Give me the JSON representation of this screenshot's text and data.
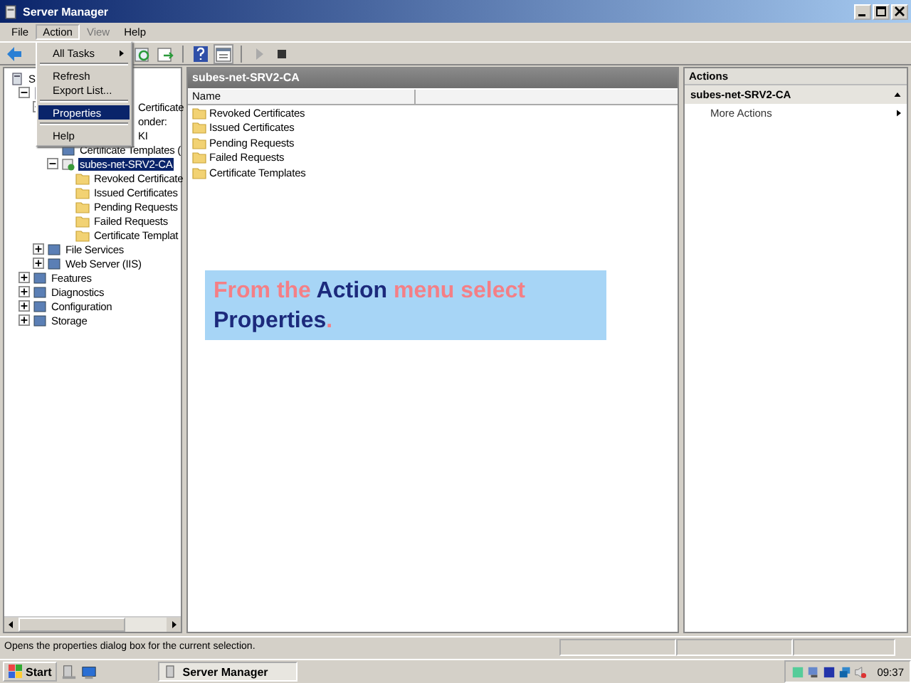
{
  "window": {
    "title": "Server Manager"
  },
  "menu_bar": [
    {
      "label": "File",
      "selected": false
    },
    {
      "label": "Action",
      "selected": true
    },
    {
      "label": "View",
      "selected": false
    },
    {
      "label": "Help",
      "selected": false
    }
  ],
  "action_menu": [
    {
      "kind": "submenu",
      "label": "All Tasks",
      "selected": false
    },
    {
      "kind": "separator"
    },
    {
      "kind": "item",
      "label": "Refresh",
      "selected": false
    },
    {
      "kind": "item",
      "label": "Export List...",
      "selected": false
    },
    {
      "kind": "separator"
    },
    {
      "kind": "item",
      "label": "Properties",
      "selected": true
    },
    {
      "kind": "separator"
    },
    {
      "kind": "item",
      "label": "Help",
      "selected": false
    }
  ],
  "tree": [
    {
      "label": "S",
      "kind": "server",
      "selected": false,
      "children": [
        {
          "kind": "server",
          "expanded": true,
          "selected": false,
          "children": [
            {
              "label": "Certificate",
              "expanded": true,
              "selected": false,
              "covered": true,
              "children": [
                {
                  "label": "onder:",
                  "selected": false,
                  "covered": true
                },
                {
                  "label": "KI",
                  "selected": false,
                  "covered": true
                },
                {
                  "label": "Certificate Templates (",
                  "kind": "node",
                  "selected": false
                },
                {
                  "label": "subes-net-SRV2-CA",
                  "kind": "ca",
                  "expanded": true,
                  "selected": true,
                  "children": [
                    {
                      "label": "Revoked Certificate",
                      "kind": "folder",
                      "selected": false
                    },
                    {
                      "label": "Issued Certificates",
                      "kind": "folder",
                      "selected": false
                    },
                    {
                      "label": "Pending Requests",
                      "kind": "folder",
                      "selected": false
                    },
                    {
                      "label": "Failed Requests",
                      "kind": "folder",
                      "selected": false
                    },
                    {
                      "label": "Certificate Templat",
                      "kind": "folder",
                      "selected": false
                    }
                  ]
                }
              ]
            },
            {
              "label": "File Services",
              "kind": "node",
              "expanded": false,
              "selected": false
            },
            {
              "label": "Web Server (IIS)",
              "kind": "node",
              "expanded": false,
              "selected": false
            }
          ]
        },
        {
          "label": "Features",
          "kind": "node",
          "expanded": false,
          "selected": false
        },
        {
          "label": "Diagnostics",
          "kind": "node",
          "expanded": false,
          "selected": false
        },
        {
          "label": "Configuration",
          "kind": "node",
          "expanded": false,
          "selected": false
        },
        {
          "label": "Storage",
          "kind": "node",
          "expanded": false,
          "selected": false
        }
      ]
    }
  ],
  "center": {
    "title": "subes-net-SRV2-CA",
    "columns": [
      "Name"
    ],
    "items": [
      "Revoked Certificates",
      "Issued Certificates",
      "Pending Requests",
      "Failed Requests",
      "Certificate Templates"
    ]
  },
  "actions": {
    "title": "Actions",
    "section": "subes-net-SRV2-CA",
    "items": [
      "More Actions"
    ]
  },
  "callout": [
    {
      "text": "From the",
      "color": "#f47f86"
    },
    {
      "text": "Action",
      "color": "#1c2a7c"
    },
    {
      "text": "menu select",
      "color": "#f47f86"
    },
    {
      "text": "Properties",
      "color": "#1c2a7c"
    },
    {
      "text": ".",
      "color": "#f47f86"
    }
  ],
  "status_bar": "Opens the properties dialog box for the current selection.",
  "taskbar": {
    "start": "Start",
    "tasks": [
      "Server Manager"
    ],
    "clock": "09:37"
  }
}
